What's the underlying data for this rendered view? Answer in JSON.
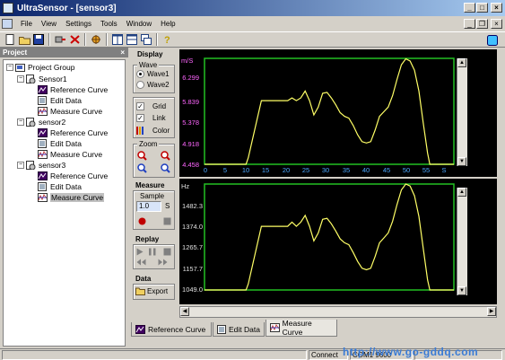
{
  "window": {
    "title": "UltraSensor - [sensor3]"
  },
  "menu": [
    "File",
    "View",
    "Settings",
    "Tools",
    "Window",
    "Help"
  ],
  "project_panel": {
    "header": "Project",
    "root": "Project Group",
    "sensors": [
      {
        "name": "Sensor1",
        "children": [
          "Reference Curve",
          "Edit Data",
          "Measure Curve"
        ]
      },
      {
        "name": "sensor2",
        "children": [
          "Reference Curve",
          "Edit Data",
          "Measure Curve"
        ]
      },
      {
        "name": "sensor3",
        "children": [
          "Reference Curve",
          "Edit Data",
          "Measure Curve"
        ]
      }
    ],
    "selected": "sensor3 / Measure Curve"
  },
  "controls": {
    "display_label": "Display",
    "wave_label": "Wave",
    "wave1": "Wave1",
    "wave2": "Wave2",
    "wave_selected": "Wave1",
    "grid_label": "Grid",
    "grid_checked": true,
    "link_label": "Link",
    "link_checked": true,
    "color_label": "Color",
    "zoom_label": "Zoom",
    "measure_label": "Measure",
    "sample_label": "Sample",
    "sample_value": "1.0",
    "sample_unit": "S",
    "replay_label": "Replay",
    "data_label": "Data",
    "export_label": "Export"
  },
  "charts": {
    "top_unit": "m/S",
    "top_yticks": [
      "6.299",
      "5.839",
      "5.378",
      "4.918",
      "4.458"
    ],
    "bottom_unit": "Hz",
    "bottom_yticks": [
      "1482.3",
      "1374.0",
      "1265.7",
      "1157.7",
      "1049.0"
    ],
    "xticks": [
      "0",
      "5",
      "10",
      "15",
      "20",
      "25",
      "30",
      "35",
      "40",
      "45",
      "50",
      "55",
      "S"
    ],
    "line_color": "#ffff66",
    "grid_color": "#22c022"
  },
  "chart_data": [
    {
      "type": "line",
      "title": "",
      "xlabel": "S",
      "ylabel": "m/S",
      "xlim": [
        0,
        57
      ],
      "ylim": [
        4.458,
        6.759
      ],
      "series": [
        {
          "x": [
            0,
            9.5,
            10,
            13,
            14,
            19,
            20,
            21,
            22,
            23,
            24,
            25,
            26,
            27,
            28,
            29,
            30,
            31,
            32,
            33,
            34,
            35,
            36,
            37,
            38,
            39,
            40,
            41,
            42,
            43,
            44,
            45,
            46,
            47,
            48,
            49,
            50,
            51,
            51.5,
            57
          ],
          "values": [
            4.458,
            4.458,
            4.6,
            5.84,
            5.84,
            5.84,
            5.9,
            5.84,
            5.9,
            6.05,
            5.84,
            5.53,
            5.7,
            6.0,
            6.02,
            5.9,
            5.75,
            5.58,
            5.5,
            5.46,
            5.3,
            5.1,
            4.95,
            4.92,
            4.95,
            5.2,
            5.5,
            5.6,
            5.7,
            5.95,
            6.3,
            6.62,
            6.75,
            6.7,
            6.5,
            6.05,
            5.35,
            4.7,
            4.458,
            4.458
          ]
        }
      ]
    },
    {
      "type": "line",
      "title": "",
      "xlabel": "S",
      "ylabel": "Hz",
      "xlim": [
        0,
        57
      ],
      "ylim": [
        1049.0,
        1590
      ],
      "series": [
        {
          "x": [
            0,
            9.5,
            10,
            13,
            14,
            19,
            20,
            21,
            22,
            23,
            24,
            25,
            26,
            27,
            28,
            29,
            30,
            31,
            32,
            33,
            34,
            35,
            36,
            37,
            38,
            39,
            40,
            41,
            42,
            43,
            44,
            45,
            46,
            47,
            48,
            49,
            50,
            51,
            51.5,
            57
          ],
          "values": [
            1049.0,
            1049.0,
            1080,
            1374.0,
            1374.0,
            1374.0,
            1395,
            1374.0,
            1395,
            1430,
            1374.0,
            1300,
            1340,
            1410,
            1415,
            1387,
            1350,
            1310,
            1290,
            1280,
            1240,
            1195,
            1160,
            1152,
            1160,
            1220,
            1290,
            1315,
            1340,
            1400,
            1485,
            1560,
            1590,
            1580,
            1530,
            1425,
            1260,
            1100,
            1049.0,
            1049.0
          ]
        }
      ]
    }
  ],
  "tabs": [
    "Reference Curve",
    "Edit Data",
    "Measure Curve"
  ],
  "active_tab": "Measure Curve",
  "status": {
    "connection": "Connect",
    "port": "COM1 9600",
    "watermark": "http://www.go-gddq.com"
  }
}
